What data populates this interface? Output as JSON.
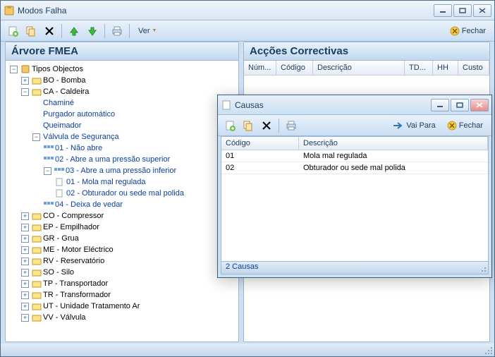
{
  "main": {
    "title": "Modos Falha",
    "toolbar_menu": "Ver",
    "close_label": "Fechar",
    "left_panel_title": "Árvore FMEA",
    "right_panel_title": "Acções Correctivas",
    "grid_columns": [
      "Núm...",
      "Código",
      "Descrição",
      "TD...",
      "HH",
      "Custo"
    ]
  },
  "tree": {
    "root": "Tipos Objectos",
    "items": [
      {
        "label": "BO - Bomba"
      },
      {
        "label": "CA - Caldeira",
        "children": [
          {
            "label": "Chaminé",
            "blue": true
          },
          {
            "label": "Purgador automático",
            "blue": true
          },
          {
            "label": "Queimador",
            "blue": true
          },
          {
            "label": "Válvula de Segurança",
            "blue": true,
            "children": [
              {
                "label": "01 - Não abre",
                "blue": true
              },
              {
                "label": "02 - Abre a uma pressão superior",
                "blue": true
              },
              {
                "label": "03 - Abre a uma pressão inferior",
                "blue": true,
                "children": [
                  {
                    "label": "01 - Mola mal regulada",
                    "blue": true
                  },
                  {
                    "label": "02 - Obturador ou sede mal polida",
                    "blue": true
                  }
                ]
              },
              {
                "label": "04 - Deixa de vedar",
                "blue": true
              }
            ]
          }
        ]
      },
      {
        "label": "CO - Compressor"
      },
      {
        "label": "EP - Empilhador"
      },
      {
        "label": "GR - Grua"
      },
      {
        "label": "ME - Motor Eléctrico"
      },
      {
        "label": "RV - Reservatório"
      },
      {
        "label": "SO - Silo"
      },
      {
        "label": "TP - Transportador"
      },
      {
        "label": "TR - Transformador"
      },
      {
        "label": "UT - Unidade Tratamento Ar"
      },
      {
        "label": "VV - Válvula"
      }
    ]
  },
  "child": {
    "title": "Causas",
    "goto_label": "Vai Para",
    "close_label": "Fechar",
    "columns": [
      "Código",
      "Descrição"
    ],
    "rows": [
      {
        "codigo": "01",
        "descricao": "Mola mal regulada"
      },
      {
        "codigo": "02",
        "descricao": "Obturador ou sede mal polida"
      }
    ],
    "status": "2 Causas"
  }
}
